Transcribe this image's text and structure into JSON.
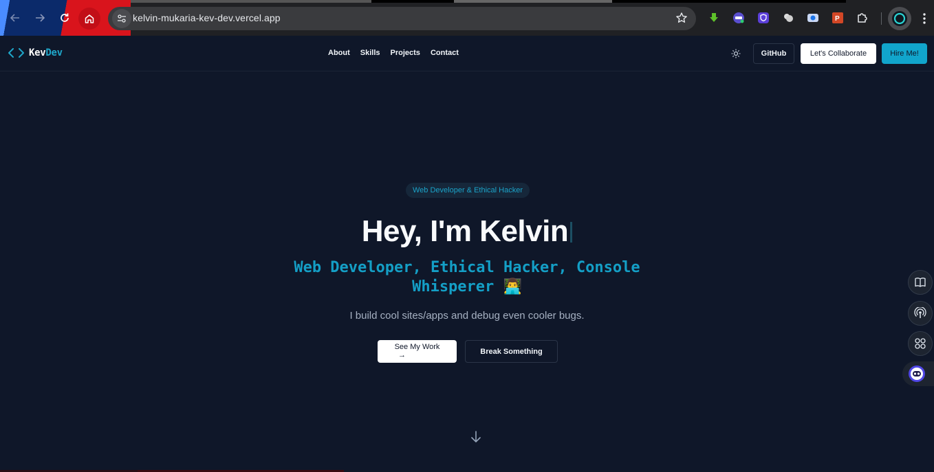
{
  "browser": {
    "url": "kelvin-mukaria-kev-dev.vercel.app",
    "icons": [
      "back-arrow-icon",
      "forward-arrow-icon",
      "reload-icon",
      "home-icon",
      "site-info-icon",
      "bookmark-star-icon",
      "extensions-puzzle-icon",
      "profile-icon",
      "menu-kebab-icon"
    ]
  },
  "site": {
    "logo": {
      "part1": "Kev",
      "part2": "Dev"
    },
    "nav": [
      "About",
      "Skills",
      "Projects",
      "Contact"
    ],
    "header_buttons": {
      "github": "GitHub",
      "collaborate": "Let's Collaborate",
      "hire": "Hire Me!"
    }
  },
  "hero": {
    "badge": "Web Developer & Ethical Hacker",
    "title": "Hey, I'm Kelvin",
    "subtitle": "Web Developer, Ethical Hacker, Console Whisperer 👨‍💻",
    "description": "I build cool sites/apps and debug even cooler bugs.",
    "cta_primary": "See My Work",
    "cta_primary_arrow": "→",
    "cta_secondary": "Break Something"
  },
  "colors": {
    "background": "#0f1729",
    "accent": "#11a5cc",
    "text": "#f8fafc",
    "muted": "#a6b1c2"
  }
}
